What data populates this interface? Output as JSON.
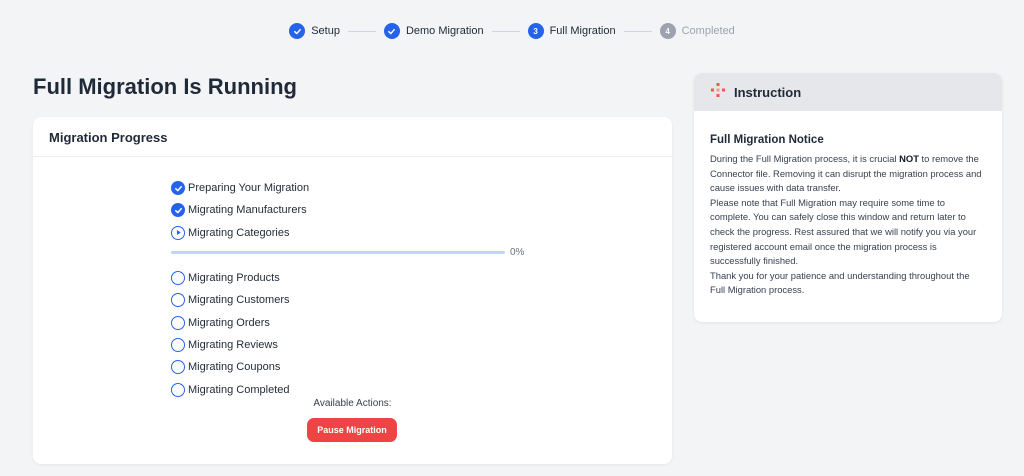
{
  "stepper": {
    "steps": [
      {
        "label": "Setup",
        "state": "done",
        "number": ""
      },
      {
        "label": "Demo Migration",
        "state": "done",
        "number": ""
      },
      {
        "label": "Full Migration",
        "state": "active",
        "number": "3"
      },
      {
        "label": "Completed",
        "state": "pending",
        "number": "4"
      }
    ]
  },
  "page": {
    "title": "Full Migration Is Running"
  },
  "progress": {
    "header": "Migration Progress",
    "tasks": [
      {
        "label": "Preparing Your Migration",
        "state": "done"
      },
      {
        "label": "Migrating Manufacturers",
        "state": "done"
      },
      {
        "label": "Migrating Categories",
        "state": "running"
      },
      {
        "label": "Migrating Products",
        "state": "pending"
      },
      {
        "label": "Migrating Customers",
        "state": "pending"
      },
      {
        "label": "Migrating Orders",
        "state": "pending"
      },
      {
        "label": "Migrating Reviews",
        "state": "pending"
      },
      {
        "label": "Migrating Coupons",
        "state": "pending"
      },
      {
        "label": "Migrating Completed",
        "state": "pending"
      }
    ],
    "current_percent": 0,
    "current_percent_label": "0%",
    "actions_label": "Available Actions:",
    "pause_button": "Pause Migration"
  },
  "instruction": {
    "header": "Instruction",
    "notice_title": "Full Migration Notice",
    "para1_before": "During the Full Migration process, it is crucial ",
    "para1_bold": "NOT",
    "para1_after": " to remove the Connector file. Removing it can disrupt the migration process and cause issues with data transfer.",
    "para2": "Please note that Full Migration may require some time to complete. You can safely close this window and return later to check the progress. Rest assured that we will notify you via your registered account email once the migration process is successfully finished.",
    "para3": "Thank you for your patience and understanding throughout the Full Migration process."
  },
  "colors": {
    "accent": "#2563eb",
    "danger": "#ef4444",
    "instruction_icon": "#ef5a4a"
  }
}
